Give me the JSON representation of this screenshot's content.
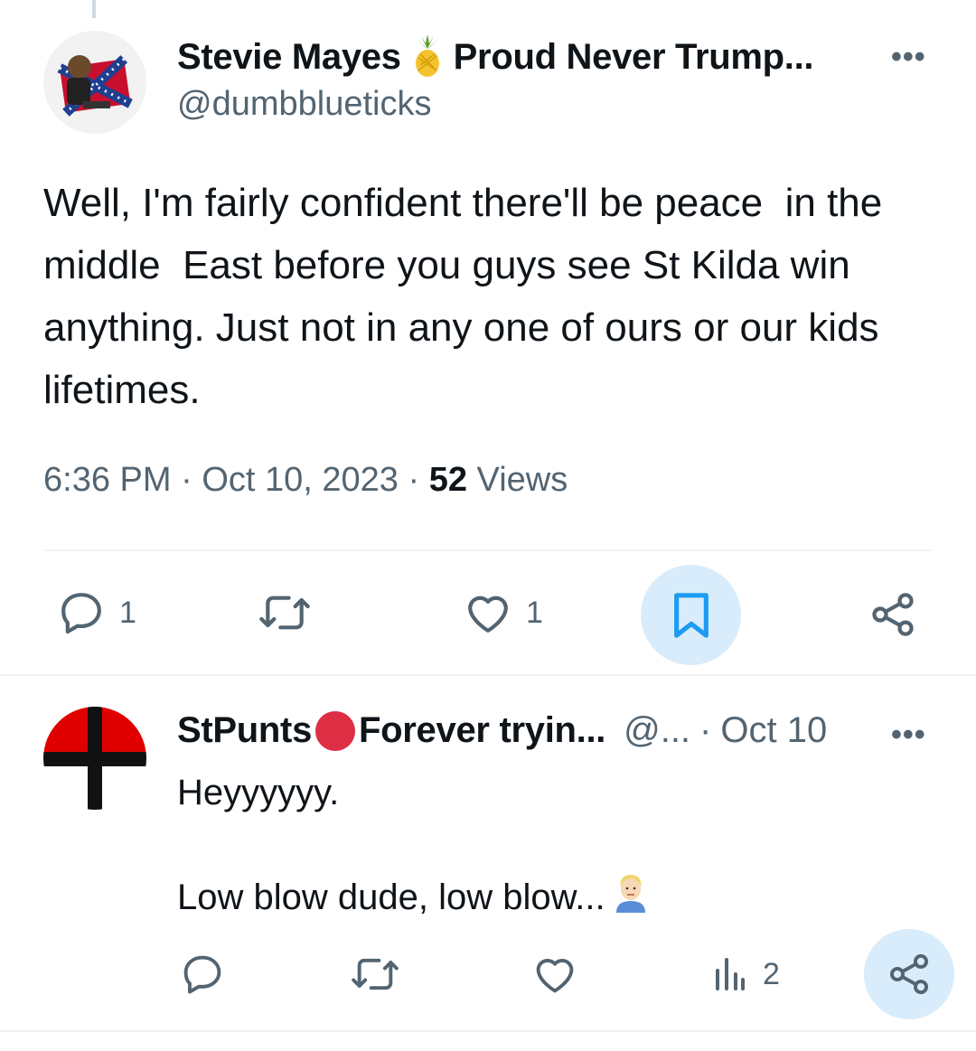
{
  "tweet": {
    "display_name": "Stevie Mayes",
    "name_suffix": "Proud Never Trump...",
    "name_emoji": "pineapple-icon",
    "handle": "@dumbblueticks",
    "text": "Well, I'm fairly confident there'll be peace  in the middle  East before you guys see St Kilda win anything. Just not in any one of ours or our kids lifetimes.",
    "time": "6:36 PM",
    "date": "Oct 10, 2023",
    "sep": "·",
    "views_count": "52",
    "views_label": "Views",
    "reply_count": "1",
    "like_count": "1",
    "more_label": "•••"
  },
  "reply": {
    "display_name": "StPunts",
    "name_suffix": "Forever tryin...",
    "handle": "@...",
    "sep": "·",
    "date": "Oct 10",
    "line1": "Heyyyyyy.",
    "line2": "Low blow dude, low blow...",
    "views_count": "2",
    "more_label": "•••"
  },
  "colors": {
    "accent": "#1d9bf0",
    "muted": "#536471",
    "highlight_bg": "#d8ecfb",
    "red_dot": "#dd2e44"
  }
}
